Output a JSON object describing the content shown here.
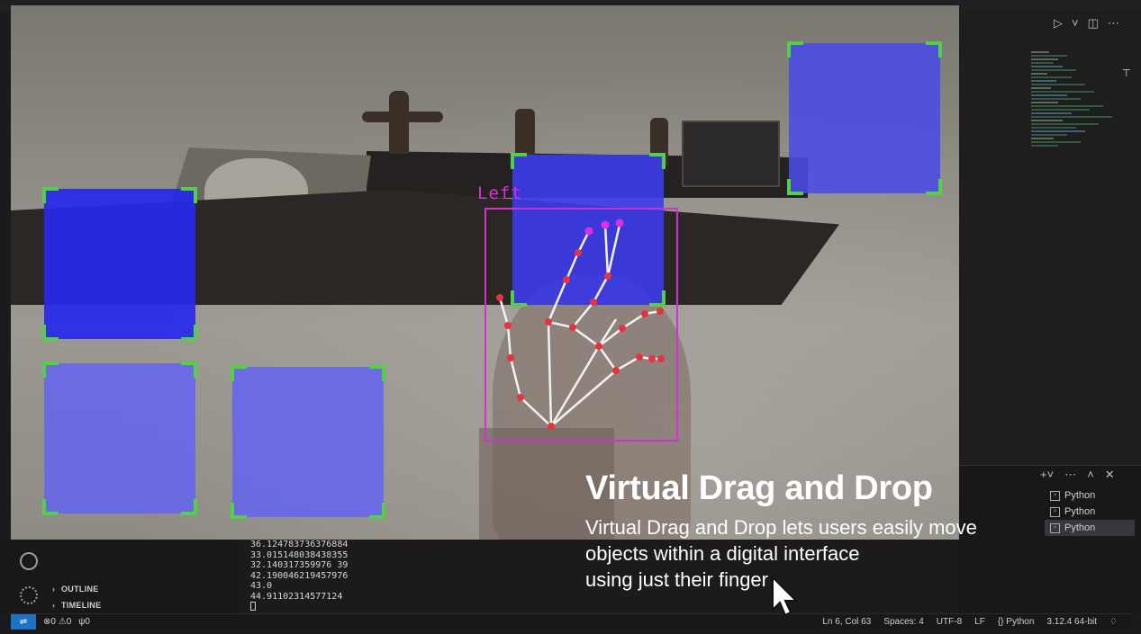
{
  "camera": {
    "hand_label": "Left",
    "drop_box_color": "#4a4ae6",
    "corner_color": "#53d146",
    "hand_box_color": "#d42fd4"
  },
  "terminal": {
    "output_lines": [
      "36.124783736376884",
      "33.015148038438355",
      "32.140317359976 39",
      "42.190046219457976",
      "43.0",
      "44.91102314577124"
    ],
    "tabs": [
      "Python",
      "Python",
      "Python"
    ]
  },
  "sidebar": {
    "sections": [
      "OUTLINE",
      "TIMELINE"
    ]
  },
  "statusbar": {
    "errors": "0",
    "warnings": "0",
    "ports": "0",
    "position": "Ln 6, Col 63",
    "spaces": "Spaces: 4",
    "encoding": "UTF-8",
    "eol": "LF",
    "language": "Python",
    "interpreter": "3.12.4 64-bit"
  },
  "caption": {
    "title": "Virtual Drag and Drop",
    "lines": [
      "Virtual Drag and Drop lets users easily move",
      "objects within a digital interface",
      "using just their finger"
    ]
  }
}
